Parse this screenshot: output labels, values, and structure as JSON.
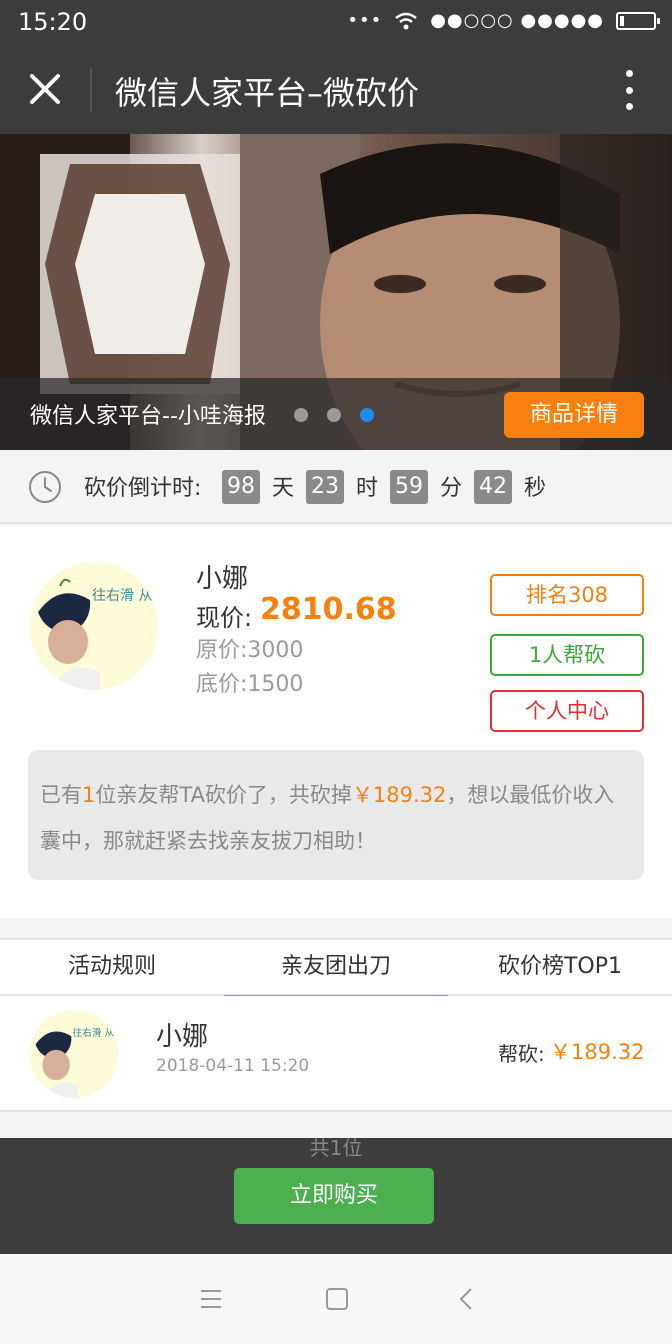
{
  "status_bar": {
    "time": "15:20",
    "signal": "●●○○○ ●●●●●"
  },
  "title_bar": {
    "title": "微信人家平台–微砍价"
  },
  "banner": {
    "caption": "微信人家平台--小哇海报",
    "detail_button": "商品详情",
    "accent": "#1b8cf0"
  },
  "countdown": {
    "label": "砍价倒计时:",
    "days": "98",
    "days_unit": "天",
    "hours": "23",
    "hours_unit": "时",
    "minutes": "59",
    "minutes_unit": "分",
    "seconds": "42",
    "seconds_unit": "秒"
  },
  "product": {
    "name": "小娜",
    "current_label": "现价:",
    "current_price": "2810.68",
    "original_price": "原价:3000",
    "floor_price": "底价:1500",
    "rank_button": "排名308",
    "helped_button": "1人帮砍",
    "center_button": "个人中心",
    "message": {
      "prefix": "已有",
      "count": "1",
      "middle": "位亲友帮TA砍价了，共砍掉",
      "amount": "￥189.32",
      "suffix": "，想以最低价收入囊中，那就赶紧去找亲友拔刀相助！"
    },
    "accent_color": "#f7800f"
  },
  "tabs": [
    {
      "label": "活动规则"
    },
    {
      "label": "亲友团出刀"
    },
    {
      "label": "砍价榜TOP1"
    }
  ],
  "helpers": [
    {
      "name": "小娜",
      "date": "2018-04-11 15:20",
      "label": "帮砍:",
      "amount": "￥189.32"
    }
  ],
  "helpers_total": "共1位",
  "buy_button": "立即购买",
  "avatar_text": "往右滑 从解锁"
}
